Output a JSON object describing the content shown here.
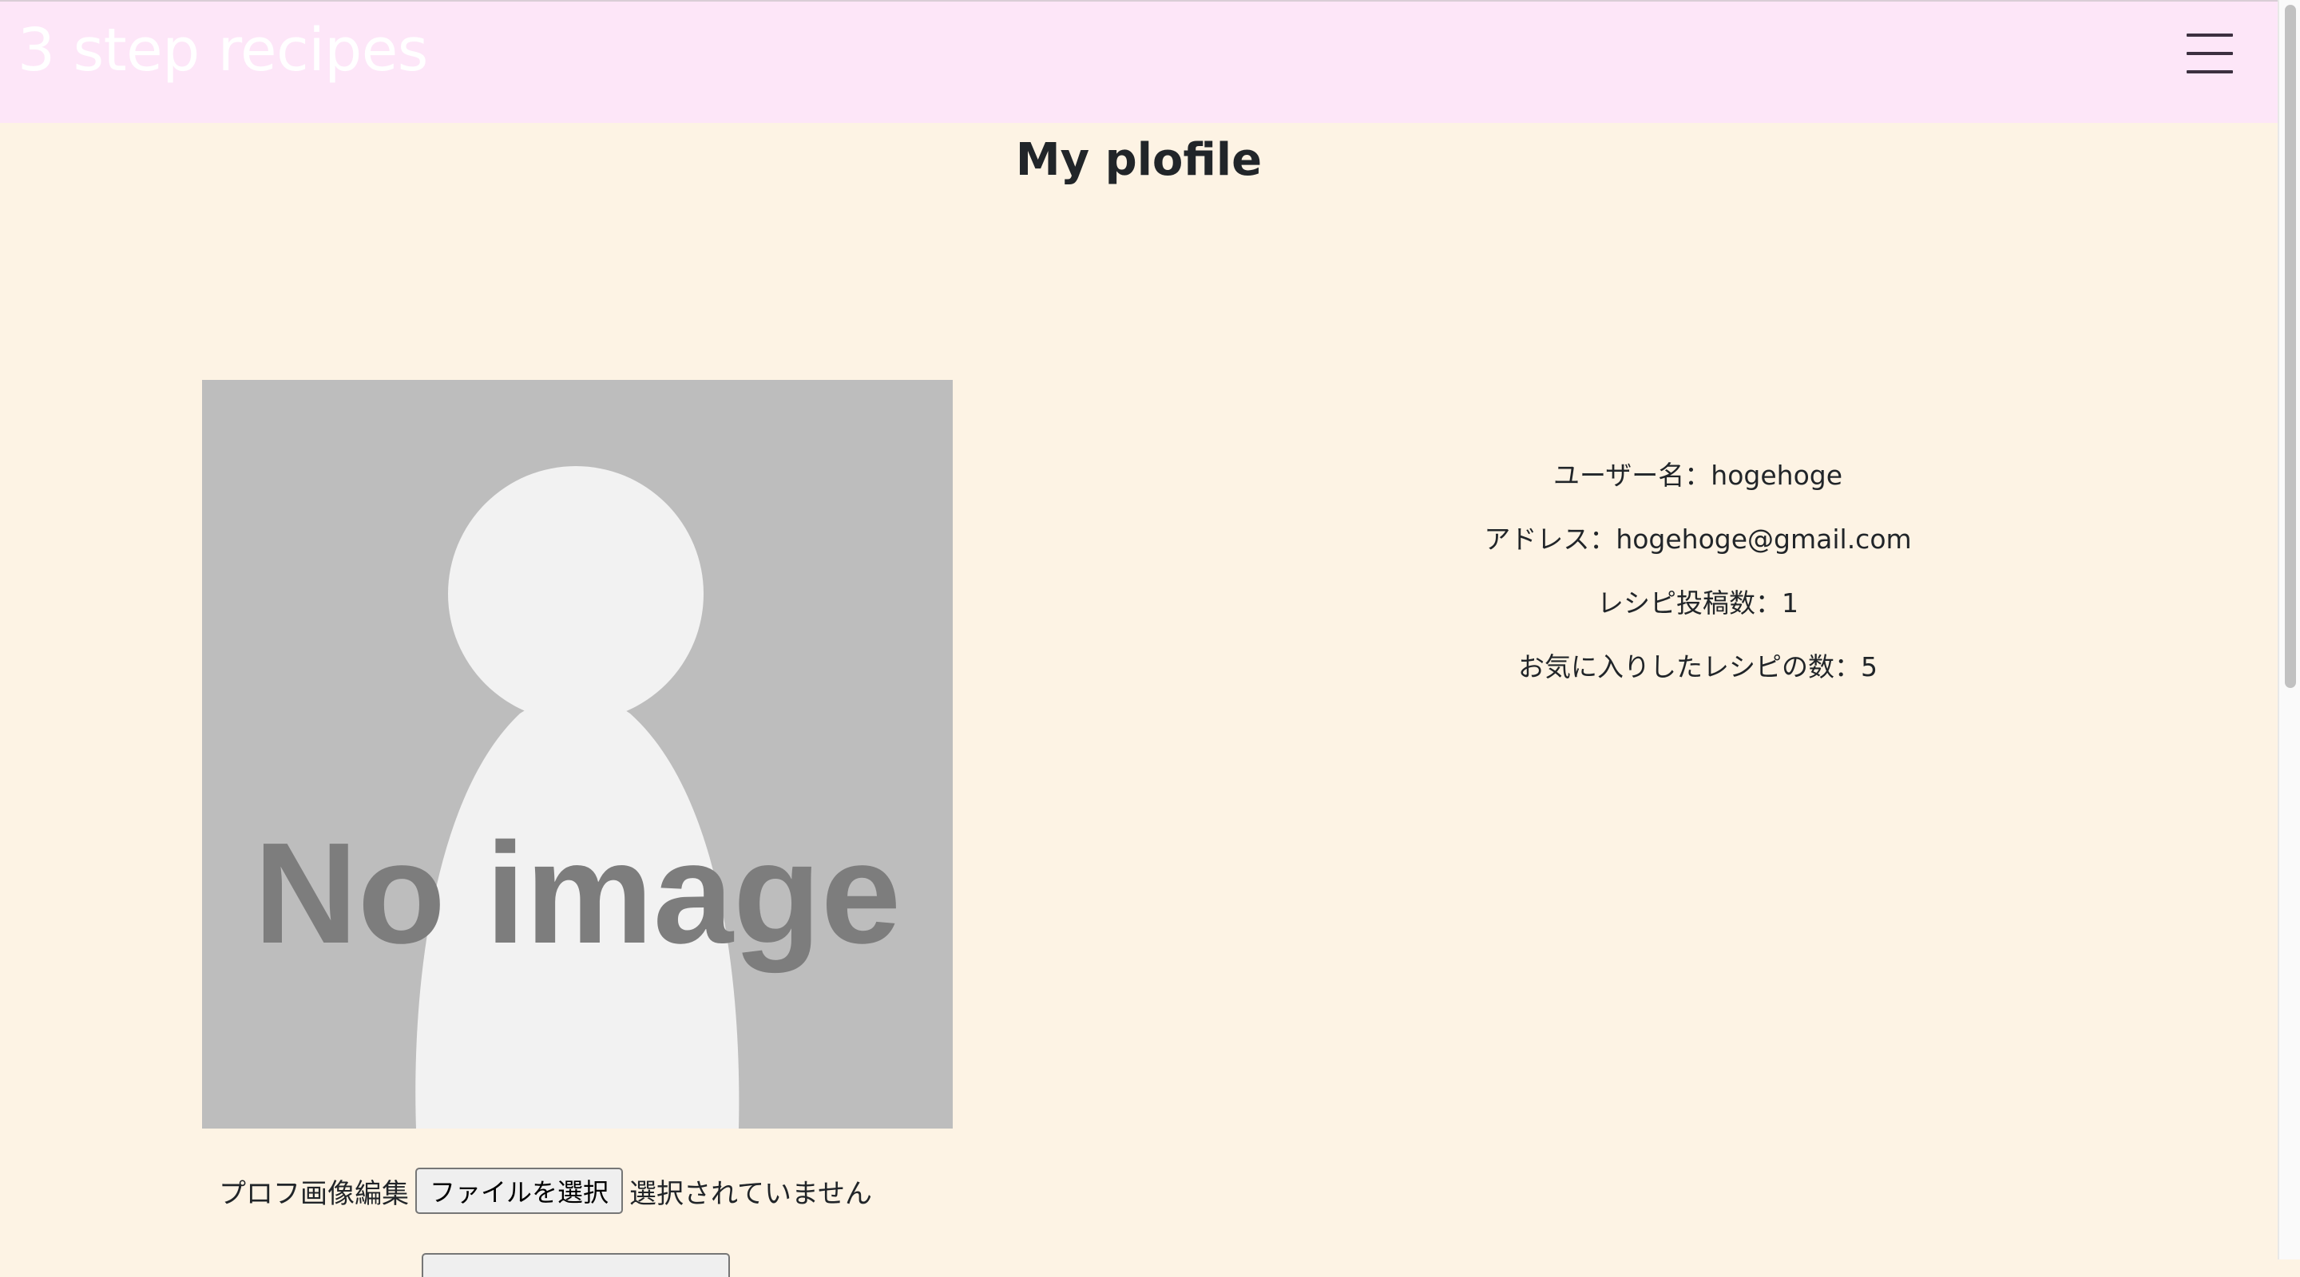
{
  "header": {
    "brand": "3 step recipes",
    "menu_icon": "hamburger-menu-icon"
  },
  "page": {
    "title": "My plofile"
  },
  "profile": {
    "image_text": "No image",
    "image_icon": "person-silhouette-icon",
    "upload_label": "プロフ画像編集",
    "file_button_label": "ファイルを選択",
    "file_status": "選択されていません"
  },
  "info": {
    "username": "ユーザー名：hogehoge",
    "address": "アドレス：hogehoge@gmail.com",
    "recipe_count": "レシピ投稿数：1",
    "favorite_count": "お気に入りしたレシピの数：5"
  },
  "colors": {
    "header_bg": "#fde6f8",
    "page_bg": "#fdf3e4",
    "placeholder_bg": "#bdbdbd",
    "silhouette": "#f2f2f2",
    "placeholder_text": "#7d7d7d"
  }
}
